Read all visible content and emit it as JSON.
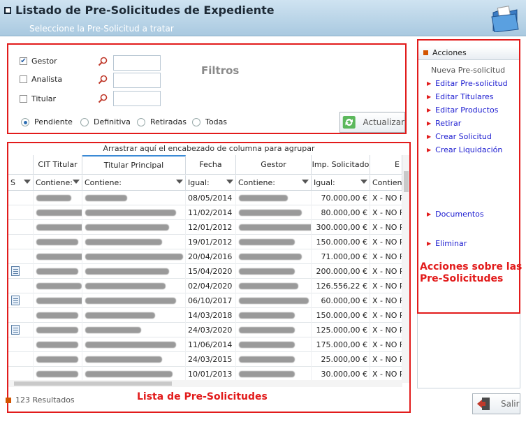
{
  "header": {
    "title": "Listado de Pre-Solicitudes de Expediente",
    "subtitle": "Seleccione la Pre-Solicitud a tratar"
  },
  "filters": {
    "label": "Filtros",
    "checkboxes": [
      {
        "label": "Gestor",
        "checked": true
      },
      {
        "label": "Analista",
        "checked": false
      },
      {
        "label": "Titular",
        "checked": false
      }
    ],
    "radios": [
      {
        "label": "Pendiente",
        "selected": true
      },
      {
        "label": "Definitiva",
        "selected": false
      },
      {
        "label": "Retiradas",
        "selected": false
      },
      {
        "label": "Todas",
        "selected": false
      }
    ],
    "update_button": "Actualizar"
  },
  "grid": {
    "group_hint": "Arrastrar aquí el encabezado de columna para agrupar",
    "columns": [
      "",
      "CIT Titular",
      "Titular Principal",
      "Fecha",
      "Gestor",
      "Imp. Solicitado",
      "E"
    ],
    "filters": [
      "S",
      "Contiene:",
      "Contiene:",
      "Igual:",
      "Contiene:",
      "Igual:",
      "Contiene"
    ],
    "rows": [
      {
        "doc": false,
        "fecha": "08/05/2014",
        "importe": "70.000,00 €",
        "estado": "X - NO R"
      },
      {
        "doc": false,
        "fecha": "11/02/2014",
        "importe": "80.000,00 €",
        "estado": "X - NO R"
      },
      {
        "doc": false,
        "fecha": "12/01/2012",
        "importe": "300.000,00 €",
        "estado": "X - NO R"
      },
      {
        "doc": false,
        "fecha": "19/01/2012",
        "importe": "150.000,00 €",
        "estado": "X - NO R"
      },
      {
        "doc": false,
        "fecha": "20/04/2016",
        "importe": "71.000,00 €",
        "estado": "X - NO R"
      },
      {
        "doc": true,
        "fecha": "15/04/2020",
        "importe": "200.000,00 €",
        "estado": "X - NO R"
      },
      {
        "doc": false,
        "fecha": "02/04/2020",
        "importe": "126.556,22 €",
        "estado": "X - NO R"
      },
      {
        "doc": true,
        "fecha": "06/10/2017",
        "importe": "60.000,00 €",
        "estado": "X - NO R"
      },
      {
        "doc": false,
        "fecha": "14/03/2018",
        "importe": "150.000,00 €",
        "estado": "X - NO R"
      },
      {
        "doc": true,
        "fecha": "24/03/2020",
        "importe": "125.000,00 €",
        "estado": "X - NO R"
      },
      {
        "doc": false,
        "fecha": "11/06/2014",
        "importe": "175.000,00 €",
        "estado": "X - NO R"
      },
      {
        "doc": false,
        "fecha": "24/03/2015",
        "importe": "25.000,00 €",
        "estado": "X - NO R"
      },
      {
        "doc": false,
        "fecha": "10/01/2013",
        "importe": "30.000,00 €",
        "estado": "X - NO R"
      }
    ],
    "list_label": "Lista de Pre-Solicitudes",
    "results": "123 Resultados"
  },
  "actions": {
    "header": "Acciones",
    "items": [
      {
        "label": "Nueva Pre-solicitud",
        "enabled": false
      },
      {
        "label": "Editar Pre-solicitud",
        "enabled": true
      },
      {
        "label": "Editar Titulares",
        "enabled": true
      },
      {
        "label": "Editar Productos",
        "enabled": true
      },
      {
        "label": "Retirar",
        "enabled": true
      },
      {
        "label": "Crear Solicitud",
        "enabled": true
      },
      {
        "label": "Crear Liquidación",
        "enabled": true
      },
      {
        "label": "Documentos",
        "enabled": true
      },
      {
        "label": "Eliminar",
        "enabled": true
      }
    ],
    "annotation": "Acciones sobre las Pre-Solicitudes"
  },
  "exit_button": "Salir",
  "colors": {
    "annotation_red": "#e21b1b",
    "link_blue": "#1b1bd0",
    "header_bg": "#a9c9e0"
  }
}
